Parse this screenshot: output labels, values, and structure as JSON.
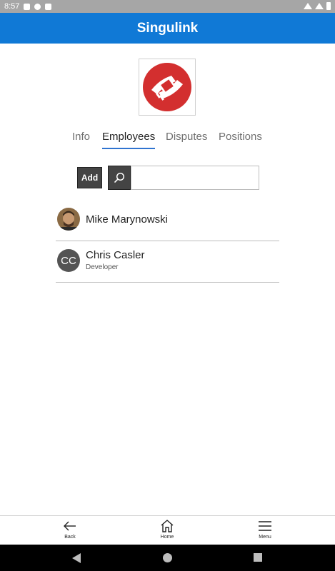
{
  "status_bar": {
    "time": "8:57"
  },
  "app_bar": {
    "title": "Singulink"
  },
  "logo": {
    "icon": "singulink-logo",
    "color": "#d32f2f"
  },
  "tabs": [
    {
      "label": "Info",
      "active": false
    },
    {
      "label": "Employees",
      "active": true
    },
    {
      "label": "Disputes",
      "active": false
    },
    {
      "label": "Positions",
      "active": false
    }
  ],
  "search": {
    "add_label": "Add",
    "placeholder": "",
    "value": ""
  },
  "employees": [
    {
      "name": "Mike Marynowski",
      "role": "",
      "avatar": "photo"
    },
    {
      "name": "Chris Casler",
      "role": "Developer",
      "avatar": "initials",
      "initials": "CC"
    }
  ],
  "bottom_nav": [
    {
      "label": "Back",
      "icon": "arrow-left-icon"
    },
    {
      "label": "Home",
      "icon": "home-icon"
    },
    {
      "label": "Menu",
      "icon": "hamburger-menu-icon"
    }
  ],
  "colors": {
    "app_bar": "#1079d6",
    "tab_underline": "#2f74d0",
    "button_dark": "#444444"
  }
}
